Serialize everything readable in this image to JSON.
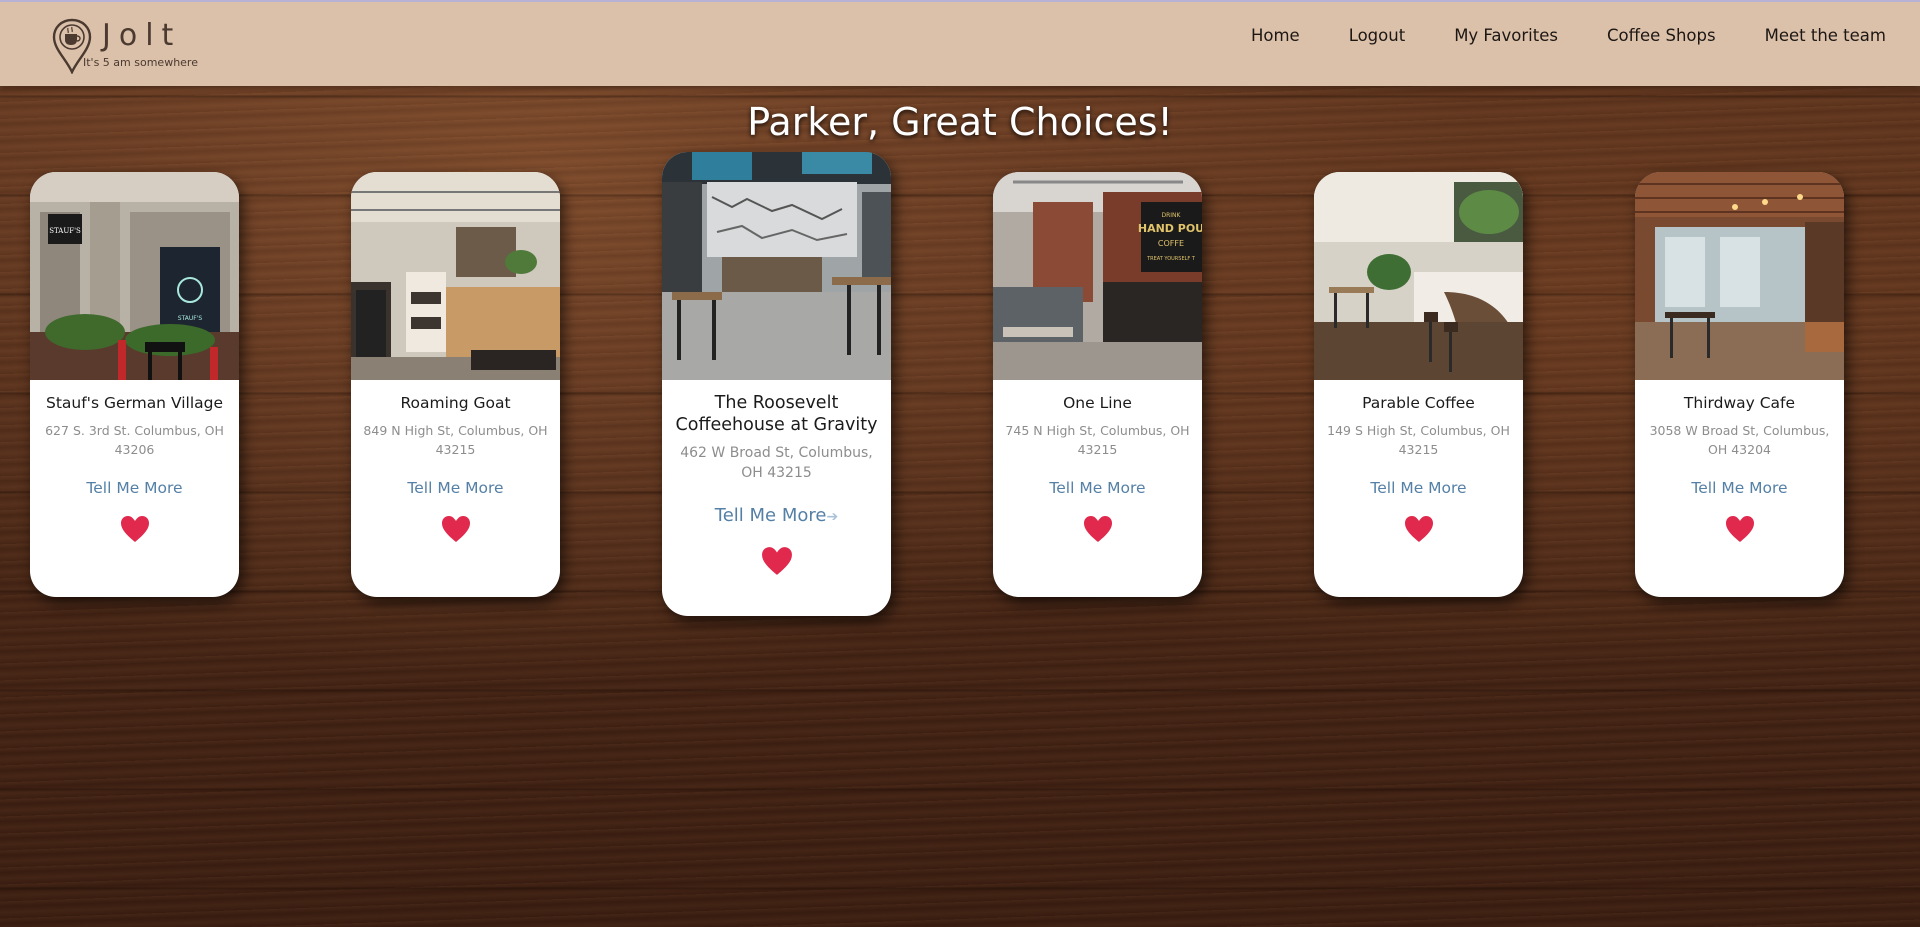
{
  "app": {
    "name": "Jolt",
    "tagline": "It's 5 am somewhere"
  },
  "nav": {
    "home": "Home",
    "logout": "Logout",
    "favorites": "My Favorites",
    "shops": "Coffee Shops",
    "team": "Meet the team"
  },
  "headline": "Parker, Great Choices!",
  "cards": [
    {
      "title": "Stauf's German Village",
      "address": "627 S. 3rd St. Columbus, OH 43206",
      "link": "Tell Me More"
    },
    {
      "title": "Roaming Goat",
      "address": "849 N High St, Columbus, OH 43215",
      "link": "Tell Me More"
    },
    {
      "title": "The Roosevelt Coffeehouse at Gravity",
      "address": "462 W Broad St, Columbus, OH 43215",
      "link": "Tell Me More"
    },
    {
      "title": "One Line",
      "address": "745 N High St, Columbus, OH 43215",
      "link": "Tell Me More"
    },
    {
      "title": "Parable Coffee",
      "address": "149 S High St, Columbus, OH 43215",
      "link": "Tell Me More"
    },
    {
      "title": "Thirdway Cafe",
      "address": "3058 W Broad St, Columbus, OH 43204",
      "link": "Tell Me More"
    }
  ],
  "photo_text": {
    "staufs_sign": "STAUF'S",
    "staufs_window": "STAUF'S",
    "oneline_sign_1": "DRINK",
    "oneline_sign_2": "HAND POU",
    "oneline_sign_3": "COFFE",
    "oneline_sign_4": "TREAT YOURSELF T"
  },
  "colors": {
    "navbar": "#dcc1aa",
    "heart": "#e0294d",
    "link": "#5580a6"
  }
}
